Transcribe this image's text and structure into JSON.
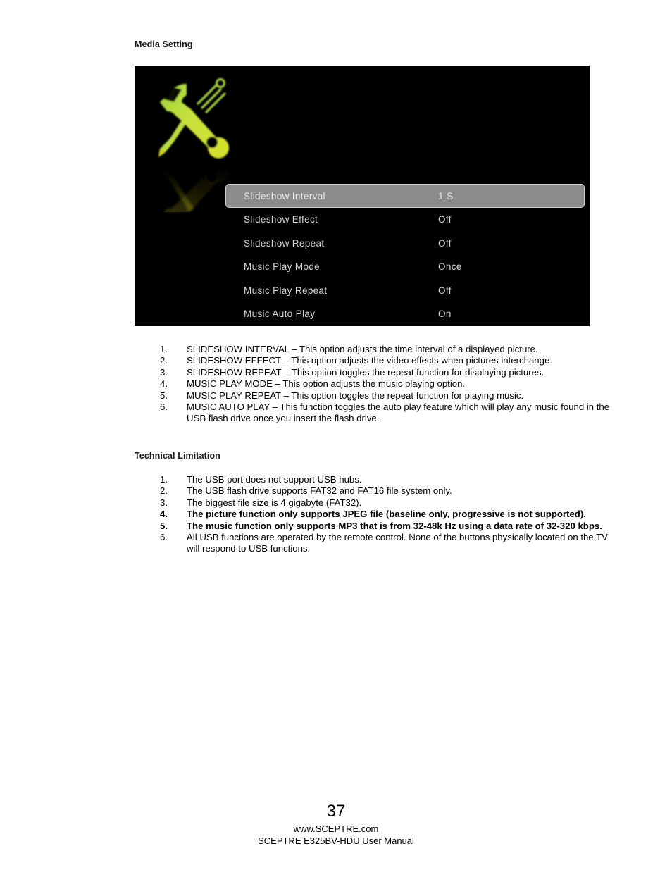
{
  "page": {
    "number": "37",
    "footer_url": "www.SCEPTRE.com",
    "footer_manual": "SCEPTRE E325BV-HDU User Manual"
  },
  "sections": {
    "media_setting": {
      "heading": "Media Setting"
    },
    "technical_limitation": {
      "heading": "Technical Limitation"
    }
  },
  "osd": {
    "icon_name": "tools-wrench-screwdriver-icon",
    "background_color": "#000000",
    "text_color": "#d5d5d5",
    "highlight_color": "#8b8b8b",
    "highlight_border_color": "#cfcfcf",
    "icon_color": "#c8e04a",
    "rows": [
      {
        "label": "Slideshow Interval",
        "value": "1 S",
        "selected": true
      },
      {
        "label": "Slideshow Effect",
        "value": "Off",
        "selected": false
      },
      {
        "label": "Slideshow Repeat",
        "value": "Off",
        "selected": false
      },
      {
        "label": "Music Play Mode",
        "value": "Once",
        "selected": false
      },
      {
        "label": "Music Play Repeat",
        "value": "Off",
        "selected": false
      },
      {
        "label": "Music Auto Play",
        "value": "On",
        "selected": false
      }
    ]
  },
  "media_list": [
    {
      "num": "1.",
      "text": "SLIDESHOW INTERVAL – This option adjusts the time interval of a displayed picture.",
      "bold": false
    },
    {
      "num": "2.",
      "text": "SLIDESHOW EFFECT – This option adjusts the video effects when pictures interchange.",
      "bold": false
    },
    {
      "num": "3.",
      "text": "SLIDESHOW REPEAT – This option toggles the repeat function for displaying pictures.",
      "bold": false
    },
    {
      "num": "4.",
      "text": "MUSIC PLAY MODE – This option adjusts the music playing option.",
      "bold": false
    },
    {
      "num": "5.",
      "text": "MUSIC PLAY REPEAT – This option toggles the repeat function for playing music.",
      "bold": false
    },
    {
      "num": "6.",
      "text": "MUSIC AUTO PLAY – This function toggles the auto play feature which will play any music found in the USB flash drive once you insert the flash drive.",
      "bold": false
    }
  ],
  "tech_list": [
    {
      "num": "1.",
      "text": "The USB port does not support USB hubs.",
      "bold": false
    },
    {
      "num": "2.",
      "text": "The USB flash drive supports FAT32 and FAT16 file system only.",
      "bold": false
    },
    {
      "num": "3.",
      "text": "The biggest file size is 4 gigabyte (FAT32).",
      "bold": false
    },
    {
      "num": "4.",
      "text": "The picture function only supports JPEG file (baseline only, progressive is not supported).",
      "bold": true
    },
    {
      "num": "5.",
      "text": "The music function only supports MP3 that is from 32-48k Hz using a data rate of 32-320 kbps.",
      "bold": true
    },
    {
      "num": "6.",
      "text": "All USB functions are operated by the remote control.  None of the buttons physically located on the TV will respond to USB functions.",
      "bold": false
    }
  ]
}
